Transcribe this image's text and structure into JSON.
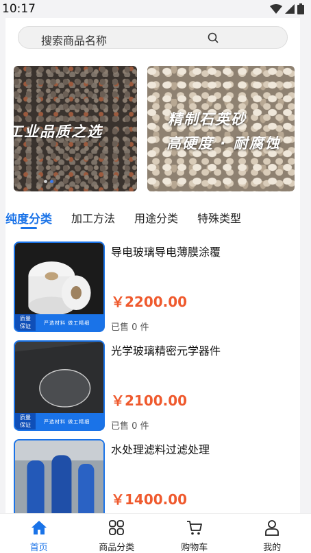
{
  "status_bar": {
    "time": "10:17"
  },
  "search": {
    "placeholder": "搜索商品名称"
  },
  "banners": [
    {
      "lines": [
        "工业品质之选"
      ]
    },
    {
      "lines": [
        "精制石英砂",
        "高硬度 · 耐腐蚀"
      ]
    }
  ],
  "tabs": [
    "纯度分类",
    "加工方法",
    "用途分类",
    "特殊类型"
  ],
  "active_tab_index": 0,
  "quality_badge": {
    "line1": "质量",
    "line2": "保证",
    "tag": "严选材料 做工精细"
  },
  "products": [
    {
      "title": "导电玻璃导电薄膜涂覆",
      "price": "￥2200.00",
      "sold": "已售 0 件"
    },
    {
      "title": "光学玻璃精密元学器件",
      "price": "￥2100.00",
      "sold": "已售 0 件"
    },
    {
      "title": "水处理滤料过滤处理",
      "price": "￥1400.00",
      "sold": ""
    }
  ],
  "tabbar": {
    "items": [
      {
        "label": "首页",
        "icon": "home-icon",
        "active": true
      },
      {
        "label": "商品分类",
        "icon": "grid-icon",
        "active": false
      },
      {
        "label": "购物车",
        "icon": "cart-icon",
        "active": false
      },
      {
        "label": "我的",
        "icon": "user-icon",
        "active": false
      }
    ]
  },
  "colors": {
    "accent": "#1a73e8",
    "price": "#ef5a2e"
  }
}
